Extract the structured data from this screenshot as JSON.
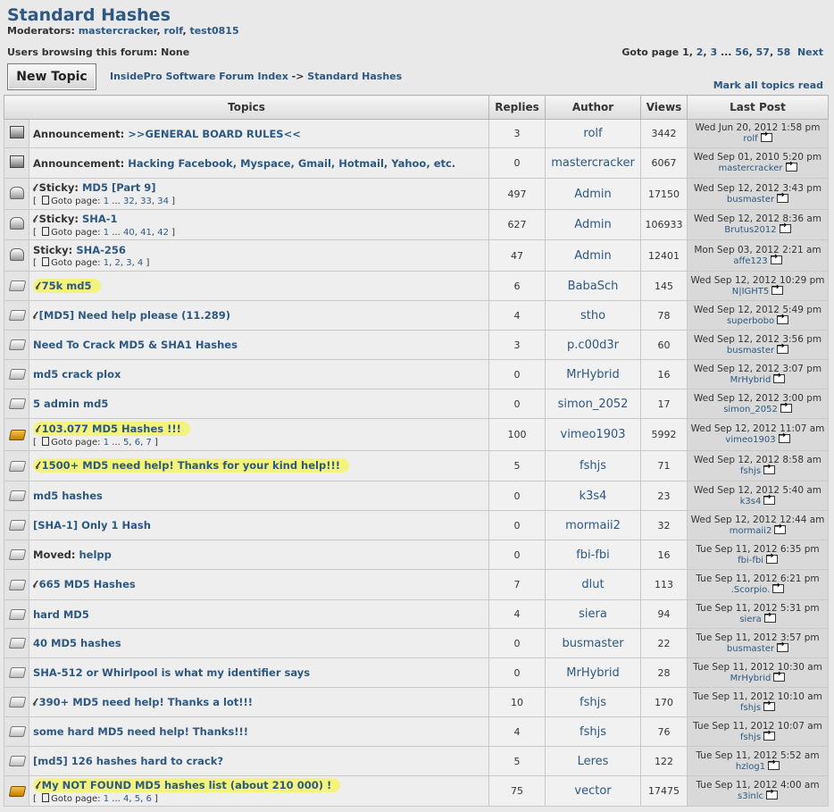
{
  "forum": {
    "title": "Standard Hashes",
    "moderators_label": "Moderators:",
    "moderators": [
      "mastercracker",
      "rolf",
      "test0815"
    ],
    "browsing": "Users browsing this forum: None",
    "goto_label": "Goto page",
    "goto_pages": [
      "1",
      "2",
      "3",
      "...",
      "56",
      "57",
      "58"
    ],
    "next": "Next",
    "new_topic": "New Topic",
    "crumb_index": "InsidePro Software Forum Index",
    "crumb_sep": "->",
    "crumb_current": "Standard Hashes",
    "mark_all": "Mark all topics read"
  },
  "table": {
    "headers": [
      "Topics",
      "Replies",
      "Author",
      "Views",
      "Last Post"
    ],
    "goto_page_label": "Goto page:",
    "rows": [
      {
        "icon": "announce-icon",
        "prefix": "Announcement:",
        "clip": false,
        "title": ">>GENERAL BOARD RULES<<",
        "highlight": false,
        "pages": [],
        "replies": "3",
        "author": "rolf",
        "views": "3442",
        "last_date": "Wed Jun 20, 2012 1:58 pm",
        "last_user": "rolf"
      },
      {
        "icon": "announce-icon",
        "prefix": "Announcement:",
        "clip": false,
        "title": "Hacking Facebook, Myspace, Gmail, Hotmail, Yahoo, etc.",
        "highlight": false,
        "pages": [],
        "replies": "0",
        "author": "mastercracker",
        "views": "6067",
        "last_date": "Wed Sep 01, 2010 5:20 pm",
        "last_user": "mastercracker"
      },
      {
        "icon": "sticky-icon",
        "prefix": "Sticky:",
        "clip": true,
        "title": "MD5 [Part 9]",
        "highlight": false,
        "pages": [
          "1",
          "...",
          "32",
          "33",
          "34"
        ],
        "replies": "497",
        "author": "Admin",
        "views": "17150",
        "last_date": "Wed Sep 12, 2012 3:43 pm",
        "last_user": "busmaster"
      },
      {
        "icon": "sticky-icon",
        "prefix": "Sticky:",
        "clip": true,
        "title": "SHA-1",
        "highlight": false,
        "pages": [
          "1",
          "...",
          "40",
          "41",
          "42"
        ],
        "replies": "627",
        "author": "Admin",
        "views": "106933",
        "last_date": "Wed Sep 12, 2012 8:36 am",
        "last_user": "Brutus2012"
      },
      {
        "icon": "sticky-icon",
        "prefix": "Sticky:",
        "clip": false,
        "title": "SHA-256",
        "highlight": false,
        "pages": [
          "1",
          "2",
          "3",
          "4"
        ],
        "replies": "47",
        "author": "Admin",
        "views": "12401",
        "last_date": "Mon Sep 03, 2012 2:21 am",
        "last_user": "affe123"
      },
      {
        "icon": "folder-icon",
        "prefix": "",
        "clip": true,
        "title": "75k md5",
        "highlight": true,
        "pages": [],
        "replies": "6",
        "author": "BabaSch",
        "views": "145",
        "last_date": "Wed Sep 12, 2012 10:29 pm",
        "last_user": "N|IGHT5"
      },
      {
        "icon": "folder-icon",
        "prefix": "",
        "clip": true,
        "title": "[MD5] Need help please (11.289)",
        "highlight": false,
        "pages": [],
        "replies": "4",
        "author": "stho",
        "views": "78",
        "last_date": "Wed Sep 12, 2012 5:49 pm",
        "last_user": "superbobo"
      },
      {
        "icon": "folder-icon",
        "prefix": "",
        "clip": false,
        "title": "Need To Crack MD5 & SHA1 Hashes",
        "highlight": false,
        "pages": [],
        "replies": "3",
        "author": "p.c00d3r",
        "views": "60",
        "last_date": "Wed Sep 12, 2012 3:56 pm",
        "last_user": "busmaster"
      },
      {
        "icon": "folder-icon",
        "prefix": "",
        "clip": false,
        "title": "md5 crack plox",
        "highlight": false,
        "pages": [],
        "replies": "0",
        "author": "MrHybrid",
        "views": "16",
        "last_date": "Wed Sep 12, 2012 3:07 pm",
        "last_user": "MrHybrid"
      },
      {
        "icon": "folder-icon",
        "prefix": "",
        "clip": false,
        "title": "5 admin md5",
        "highlight": false,
        "pages": [],
        "replies": "0",
        "author": "simon_2052",
        "views": "17",
        "last_date": "Wed Sep 12, 2012 3:00 pm",
        "last_user": "simon_2052"
      },
      {
        "icon": "folder-hot-icon",
        "prefix": "",
        "clip": true,
        "title": "103.077 MD5 Hashes !!!",
        "highlight": true,
        "pages": [
          "1",
          "...",
          "5",
          "6",
          "7"
        ],
        "replies": "100",
        "author": "vimeo1903",
        "views": "5992",
        "last_date": "Wed Sep 12, 2012 11:07 am",
        "last_user": "vimeo1903"
      },
      {
        "icon": "folder-icon",
        "prefix": "",
        "clip": true,
        "title": "1500+ MD5 need help! Thanks for your kind help!!!",
        "highlight": true,
        "pages": [],
        "replies": "5",
        "author": "fshjs",
        "views": "71",
        "last_date": "Wed Sep 12, 2012 8:58 am",
        "last_user": "fshjs"
      },
      {
        "icon": "folder-icon",
        "prefix": "",
        "clip": false,
        "title": "md5 hashes",
        "highlight": false,
        "pages": [],
        "replies": "0",
        "author": "k3s4",
        "views": "23",
        "last_date": "Wed Sep 12, 2012 5:40 am",
        "last_user": "k3s4"
      },
      {
        "icon": "folder-icon",
        "prefix": "",
        "clip": false,
        "title": "[SHA-1] Only 1 Hash",
        "highlight": false,
        "pages": [],
        "replies": "0",
        "author": "mormaii2",
        "views": "32",
        "last_date": "Wed Sep 12, 2012 12:44 am",
        "last_user": "mormaii2"
      },
      {
        "icon": "folder-icon",
        "prefix": "Moved:",
        "clip": false,
        "title": "helpp",
        "highlight": false,
        "pages": [],
        "replies": "0",
        "author": "fbi-fbi",
        "views": "16",
        "last_date": "Tue Sep 11, 2012 6:35 pm",
        "last_user": "fbi-fbi"
      },
      {
        "icon": "folder-icon",
        "prefix": "",
        "clip": true,
        "title": "665 MD5 Hashes",
        "highlight": false,
        "pages": [],
        "replies": "7",
        "author": "dlut",
        "views": "113",
        "last_date": "Tue Sep 11, 2012 6:21 pm",
        "last_user": ".Scorpio."
      },
      {
        "icon": "folder-icon",
        "prefix": "",
        "clip": false,
        "title": "hard MD5",
        "highlight": false,
        "pages": [],
        "replies": "4",
        "author": "siera",
        "views": "94",
        "last_date": "Tue Sep 11, 2012 5:31 pm",
        "last_user": "siera"
      },
      {
        "icon": "folder-icon",
        "prefix": "",
        "clip": false,
        "title": "40 MD5 hashes",
        "highlight": false,
        "pages": [],
        "replies": "0",
        "author": "busmaster",
        "views": "22",
        "last_date": "Tue Sep 11, 2012 3:57 pm",
        "last_user": "busmaster"
      },
      {
        "icon": "folder-icon",
        "prefix": "",
        "clip": false,
        "title": "SHA-512 or Whirlpool is what my identifier says",
        "highlight": false,
        "pages": [],
        "replies": "0",
        "author": "MrHybrid",
        "views": "28",
        "last_date": "Tue Sep 11, 2012 10:30 am",
        "last_user": "MrHybrid"
      },
      {
        "icon": "folder-icon",
        "prefix": "",
        "clip": true,
        "title": "390+ MD5 need help! Thanks a lot!!!",
        "highlight": false,
        "pages": [],
        "replies": "10",
        "author": "fshjs",
        "views": "170",
        "last_date": "Tue Sep 11, 2012 10:10 am",
        "last_user": "fshjs"
      },
      {
        "icon": "folder-icon",
        "prefix": "",
        "clip": false,
        "title": "some hard MD5 need help! Thanks!!!",
        "highlight": false,
        "pages": [],
        "replies": "4",
        "author": "fshjs",
        "views": "76",
        "last_date": "Tue Sep 11, 2012 10:07 am",
        "last_user": "fshjs"
      },
      {
        "icon": "folder-icon",
        "prefix": "",
        "clip": false,
        "title": "[md5] 126 hashes hard to crack?",
        "highlight": false,
        "pages": [],
        "replies": "5",
        "author": "Leres",
        "views": "122",
        "last_date": "Tue Sep 11, 2012 5:52 am",
        "last_user": "hzlog1"
      },
      {
        "icon": "folder-hot-icon",
        "prefix": "",
        "clip": true,
        "title": "My NOT FOUND MD5 hashes list (about 210 000) !",
        "highlight": true,
        "pages": [
          "1",
          "...",
          "4",
          "5",
          "6"
        ],
        "replies": "75",
        "author": "vector",
        "views": "17475",
        "last_date": "Tue Sep 11, 2012 4:00 am",
        "last_user": "s3inlc"
      }
    ]
  }
}
